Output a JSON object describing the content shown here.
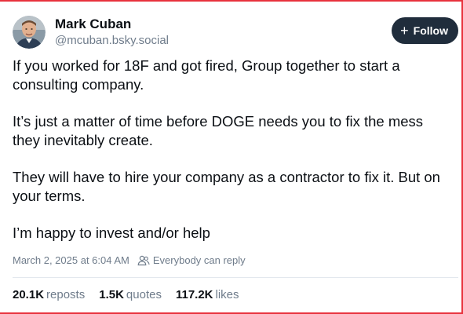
{
  "author": {
    "display_name": "Mark Cuban",
    "handle": "@mcuban.bsky.social",
    "avatar_icon": "profile-photo"
  },
  "follow_button": {
    "icon": "plus-icon",
    "label": "Follow"
  },
  "post": {
    "paragraphs": [
      "If you worked for 18F and got fired, Group together to start a consulting company.",
      "It’s just a matter of time before DOGE needs you to fix the mess they inevitably create.",
      "They will have to hire your company as a contractor to fix it. But on your terms.",
      "I’m happy to invest and/or help"
    ]
  },
  "meta": {
    "timestamp": "March 2, 2025 at 6:04 AM",
    "reply_icon": "people-icon",
    "reply_setting": "Everybody can reply"
  },
  "stats": {
    "reposts_count": "20.1K",
    "reposts_label": "reposts",
    "quotes_count": "1.5K",
    "quotes_label": "quotes",
    "likes_count": "117.2K",
    "likes_label": "likes"
  },
  "colors": {
    "follow_bg": "#202d3c",
    "muted_text": "#6f7c8b",
    "edge_accent": "#e8323c"
  }
}
